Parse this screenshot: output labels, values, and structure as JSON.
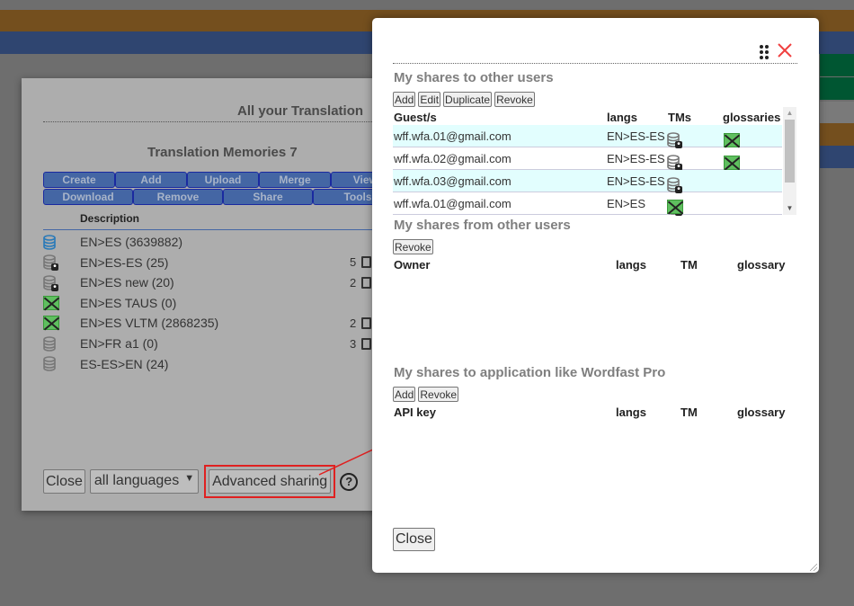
{
  "colors": {
    "accent_blue": "#4466a4",
    "highlight_red": "#e02020",
    "row_highlight": "#e2fefe",
    "close_x": "#f04040"
  },
  "tm_dialog": {
    "title": "All your Translation",
    "heading": "Translation Memories 7",
    "toolbar_row1": [
      "Create",
      "Add",
      "Upload",
      "Merge",
      "View/"
    ],
    "toolbar_row2": [
      "Download",
      "Remove",
      "Share",
      "Tools"
    ],
    "column_description": "Description",
    "items": [
      {
        "icon": "database-blue-icon",
        "label": "EN>ES (3639882)",
        "count": ""
      },
      {
        "icon": "database-shared-icon",
        "label": "EN>ES-ES (25)",
        "count": "5"
      },
      {
        "icon": "database-shared-icon",
        "label": "EN>ES new (20)",
        "count": "2"
      },
      {
        "icon": "excel-icon",
        "label": "EN>ES TAUS (0)",
        "count": ""
      },
      {
        "icon": "excel-icon",
        "label": "EN>ES VLTM (2868235)",
        "count": "2"
      },
      {
        "icon": "database-icon",
        "label": "EN>FR a1 (0)",
        "count": "3"
      },
      {
        "icon": "database-icon",
        "label": "ES-ES>EN (24)",
        "count": ""
      }
    ],
    "close_label": "Close",
    "language_select": "all languages",
    "advanced_sharing_label": "Advanced sharing",
    "help_label": "?"
  },
  "modal": {
    "shares_to_users": {
      "title": "My shares to other users",
      "buttons": [
        "Add",
        "Edit",
        "Duplicate",
        "Revoke"
      ],
      "columns": [
        "Guest/s",
        "langs",
        "TMs",
        "glossaries"
      ],
      "rows": [
        {
          "guest": "wff.wfa.01@gmail.com",
          "langs": "EN>ES-ES",
          "tms": [
            "database-shared-icon"
          ],
          "glossaries": [
            "excel-icon"
          ]
        },
        {
          "guest": "wff.wfa.02@gmail.com",
          "langs": "EN>ES-ES",
          "tms": [
            "database-shared-icon"
          ],
          "glossaries": [
            "excel-icon"
          ]
        },
        {
          "guest": "wff.wfa.03@gmail.com",
          "langs": "EN>ES-ES",
          "tms": [
            "database-shared-icon"
          ],
          "glossaries": []
        },
        {
          "guest": "wff.wfa.01@gmail.com",
          "langs": "EN>ES",
          "tms": [
            "database-shared-icon",
            "excel-icon"
          ],
          "glossaries": []
        }
      ]
    },
    "shares_from_users": {
      "title": "My shares from other users",
      "buttons": [
        "Revoke"
      ],
      "columns": [
        "Owner",
        "langs",
        "TM",
        "glossary"
      ]
    },
    "shares_to_apps": {
      "title": "My shares to application like Wordfast Pro",
      "buttons": [
        "Add",
        "Revoke"
      ],
      "columns": [
        "API key",
        "langs",
        "TM",
        "glossary"
      ]
    },
    "close_label": "Close"
  }
}
